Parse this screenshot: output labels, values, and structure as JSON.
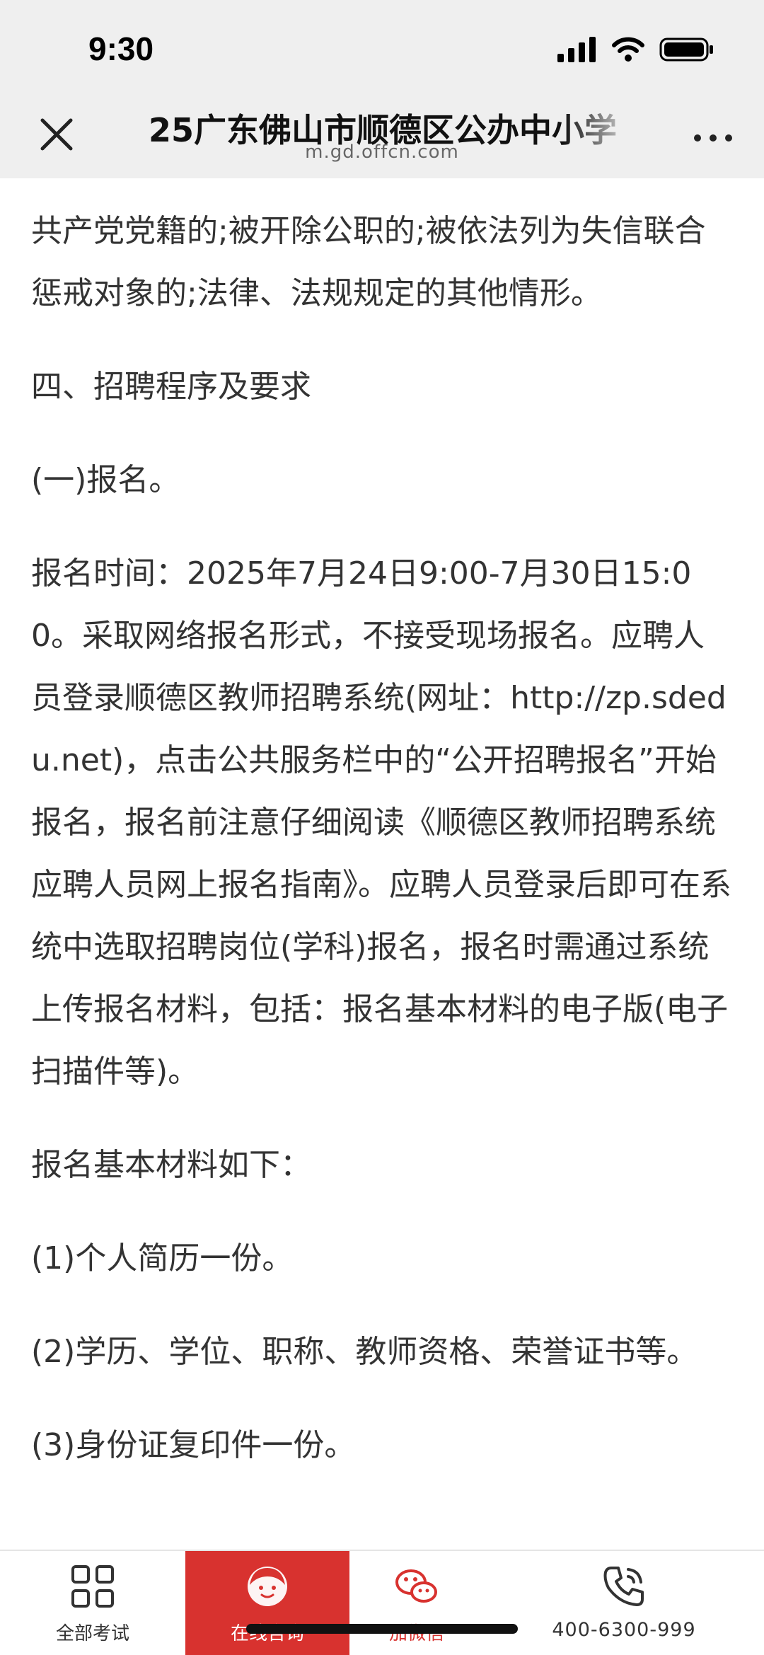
{
  "status_bar": {
    "time": "9:30"
  },
  "nav": {
    "title": "25广东佛山市顺德区公办中小学",
    "url": "m.gd.offcn.com"
  },
  "article": {
    "paragraphs": [
      "共产党党籍的;被开除公职的;被依法列为失信联合惩戒对象的;法律、法规规定的其他情形。",
      "四、招聘程序及要求",
      "(一)报名。",
      "报名时间：2025年7月24日9:00-7月30日15:00。采取网络报名形式，不接受现场报名。应聘人员登录顺德区教师招聘系统(网址：http://zp.sdedu.net)，点击公共服务栏中的“公开招聘报名”开始报名，报名前注意仔细阅读《顺德区教师招聘系统应聘人员网上报名指南》。应聘人员登录后即可在系统中选取招聘岗位(学科)报名，报名时需通过系统上传报名材料，包括：报名基本材料的电子版(电子扫描件等)。",
      "报名基本材料如下：",
      "(1)个人简历一份。",
      "(2)学历、学位、职称、教师资格、荣誉证书等。",
      "(3)身份证复印件一份。"
    ]
  },
  "bottom_bar": {
    "exams_label": "全部考试",
    "consult_label": "在线咨询",
    "wechat_label": "加微信",
    "phone_label": "400-6300-999"
  },
  "colors": {
    "accent": "#d8322f",
    "header_bg": "#efefef",
    "text": "#333333"
  },
  "icons": {
    "close": "close-icon",
    "more": "more-dots-icon",
    "exams": "grid-icon",
    "consult": "consultant-avatar-icon",
    "wechat": "wechat-icon",
    "phone": "phone-icon"
  }
}
